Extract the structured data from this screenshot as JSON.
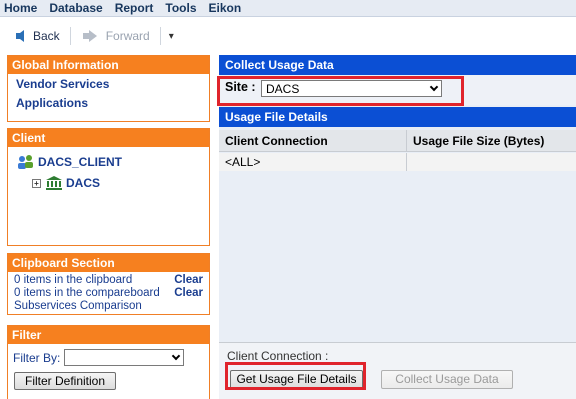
{
  "menu": {
    "items": [
      "Home",
      "Database",
      "Report",
      "Tools",
      "Eikon"
    ]
  },
  "toolbar": {
    "back_label": "Back",
    "forward_label": "Forward",
    "dropdown_glyph": "▾"
  },
  "global_info": {
    "title": "Global Information",
    "links": [
      "Vendor Services",
      "Applications"
    ]
  },
  "client_panel": {
    "title": "Client",
    "root": "DACS_CLIENT",
    "child": "DACS"
  },
  "clipboard": {
    "title": "Clipboard Section",
    "line1": "0 items in the clipboard",
    "line1_action": "Clear",
    "line2": "0 items in the compareboard",
    "line2_action": "Clear",
    "line3": "Subservices Comparison"
  },
  "filter": {
    "title": "Filter",
    "filter_by_label": "Filter By:",
    "filter_by_value": "",
    "button_label": "Filter Definition"
  },
  "collect": {
    "title": "Collect Usage Data",
    "site_label": "Site :",
    "site_value": "DACS"
  },
  "usage_details": {
    "title": "Usage File Details",
    "columns": [
      "Client Connection",
      "Usage File Size (Bytes)"
    ],
    "rows": [
      [
        "<ALL>",
        ""
      ]
    ]
  },
  "bottom": {
    "client_connection_label": "Client Connection :",
    "get_button": "Get Usage File Details",
    "collect_button": "Collect Usage Data"
  },
  "colors": {
    "orange": "#f6801f",
    "blue_header": "#0b4fd4",
    "highlight_red": "#e0242c",
    "link_blue": "#1a3d8f"
  },
  "icons": [
    "back-arrow-icon",
    "forward-arrow-icon",
    "client-group-icon",
    "bank-icon"
  ]
}
